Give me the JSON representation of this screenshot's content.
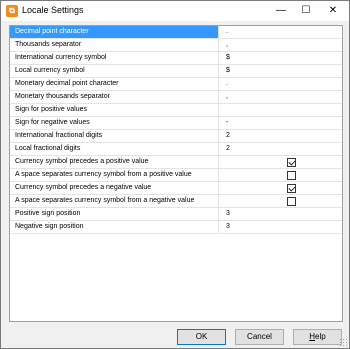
{
  "window": {
    "title": "Locale Settings",
    "icon": "app-icon",
    "controls": {
      "minimize": "—",
      "maximize": "☐",
      "close": "✕"
    }
  },
  "rows": [
    {
      "name": "Decimal point character",
      "value": ".",
      "type": "text",
      "selected": true
    },
    {
      "name": "Thousands separator",
      "value": ",",
      "type": "text"
    },
    {
      "name": "International currency symbol",
      "value": "$",
      "type": "text"
    },
    {
      "name": "Local currency symbol",
      "value": "$",
      "type": "text"
    },
    {
      "name": "Monetary decimal point character",
      "value": ".",
      "type": "text"
    },
    {
      "name": "Monetary thousands separator",
      "value": ",",
      "type": "text"
    },
    {
      "name": "Sign for positive values",
      "value": "",
      "type": "text"
    },
    {
      "name": "Sign for negative values",
      "value": "-",
      "type": "text"
    },
    {
      "name": "International fractional digits",
      "value": "2",
      "type": "text"
    },
    {
      "name": "Local fractional digits",
      "value": "2",
      "type": "text"
    },
    {
      "name": "Currency symbol precedes a positive value",
      "checked": true,
      "type": "checkbox"
    },
    {
      "name": "A space separates currency symbol from a positive value",
      "checked": false,
      "type": "checkbox"
    },
    {
      "name": "Currency symbol precedes a negative value",
      "checked": true,
      "type": "checkbox"
    },
    {
      "name": "A space separates currency symbol from a negative value",
      "checked": false,
      "type": "checkbox"
    },
    {
      "name": "Positive sign position",
      "value": "3",
      "type": "text"
    },
    {
      "name": "Negative sign position",
      "value": "3",
      "type": "text"
    }
  ],
  "buttons": {
    "ok": "OK",
    "cancel": "Cancel",
    "help_mnemonic": "H",
    "help_rest": "elp"
  },
  "colors": {
    "selection": "#3399ff",
    "default_button_border": "#0078d7"
  }
}
